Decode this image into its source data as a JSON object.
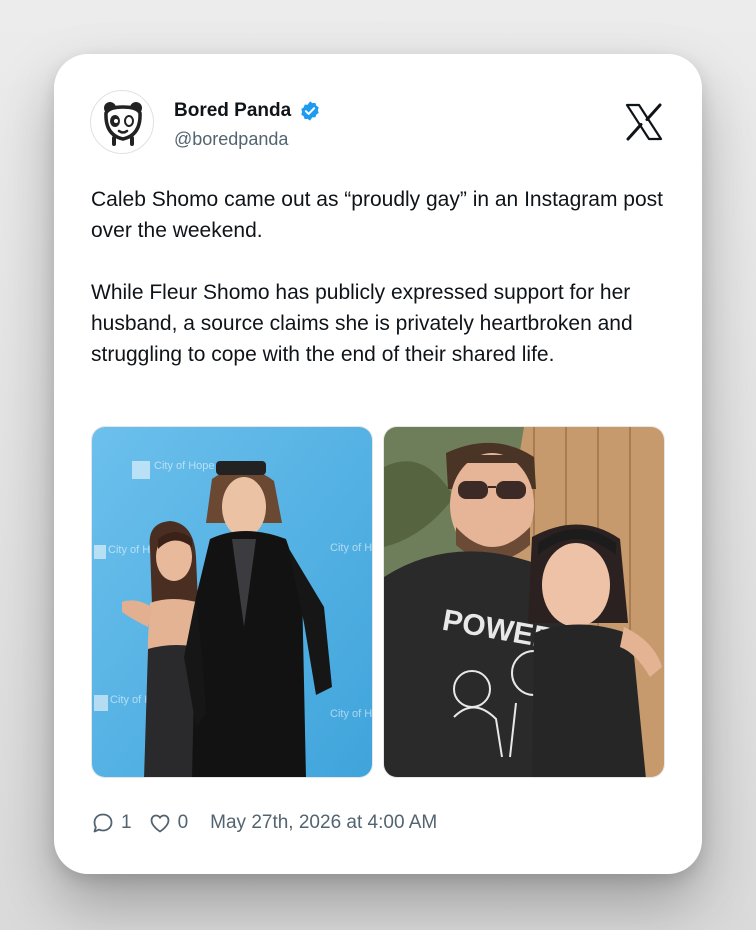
{
  "author": {
    "display_name": "Bored Panda",
    "handle": "@boredpanda",
    "verified": true,
    "avatar_icon": "panda-logo-icon"
  },
  "platform_icon": "x-logo-icon",
  "post": {
    "paragraphs": [
      "Caleb Shomo came out as “proudly gay” in an Instagram post over the weekend.",
      "While Fleur Shomo has publicly expressed support for her husband, a source claims she is privately heartbroken and struggling to cope with the end of their shared life."
    ]
  },
  "media": [
    {
      "name": "red-carpet-photo",
      "backdrop_text": "City of Hope"
    },
    {
      "name": "selfie-photo",
      "shirt_text": "POWER"
    }
  ],
  "stats": {
    "replies": "1",
    "likes": "0",
    "timestamp": "May 27th, 2026 at 4:00 AM"
  },
  "colors": {
    "verified_badge": "#1d9bf0",
    "text": "#0f1419",
    "muted": "#536471",
    "backdrop_blue": "#5ab6e6"
  }
}
